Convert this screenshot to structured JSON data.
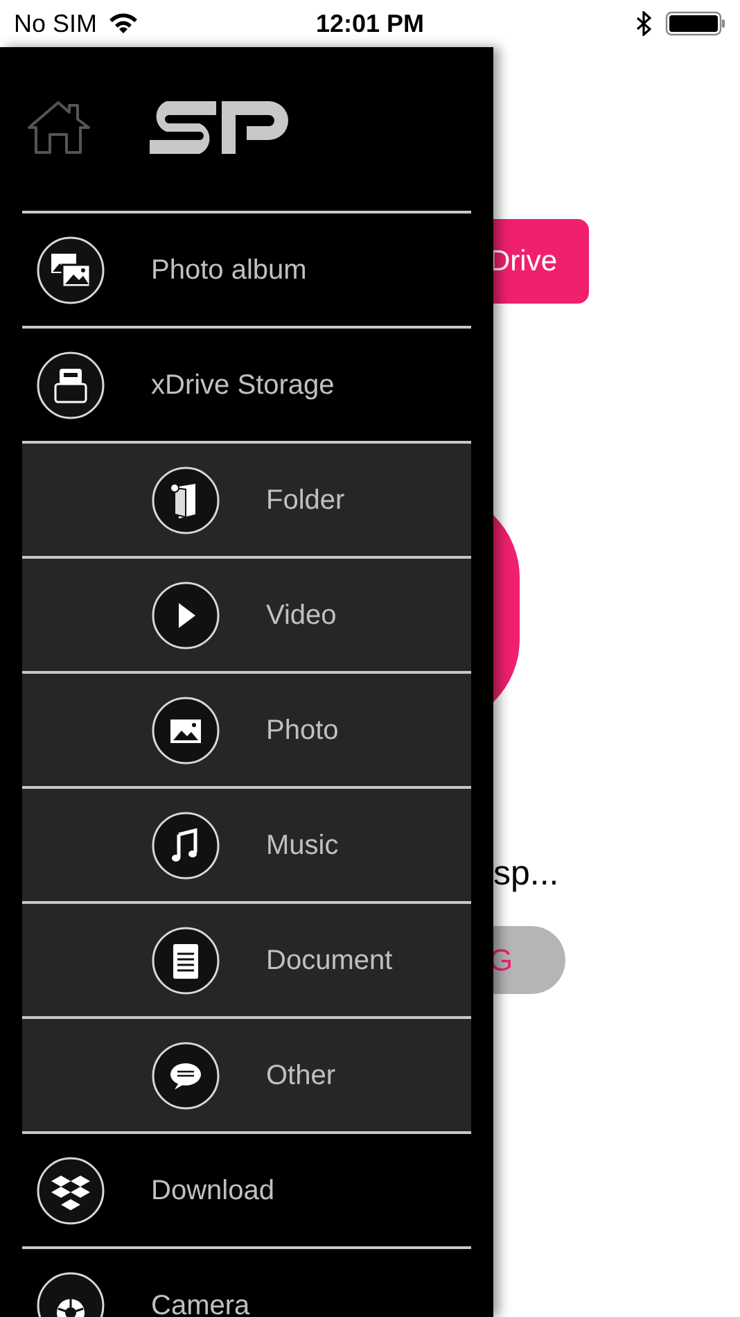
{
  "status_bar": {
    "carrier": "No SIM",
    "time": "12:01 PM"
  },
  "background": {
    "button": "Drive",
    "status_text": "sp...",
    "pill": "G"
  },
  "drawer": {
    "items": [
      {
        "label": "Photo album"
      },
      {
        "label": "xDrive Storage",
        "children": [
          {
            "label": "Folder"
          },
          {
            "label": "Video"
          },
          {
            "label": "Photo"
          },
          {
            "label": "Music"
          },
          {
            "label": "Document"
          },
          {
            "label": "Other"
          }
        ]
      },
      {
        "label": "Download"
      },
      {
        "label": "Camera"
      }
    ]
  }
}
